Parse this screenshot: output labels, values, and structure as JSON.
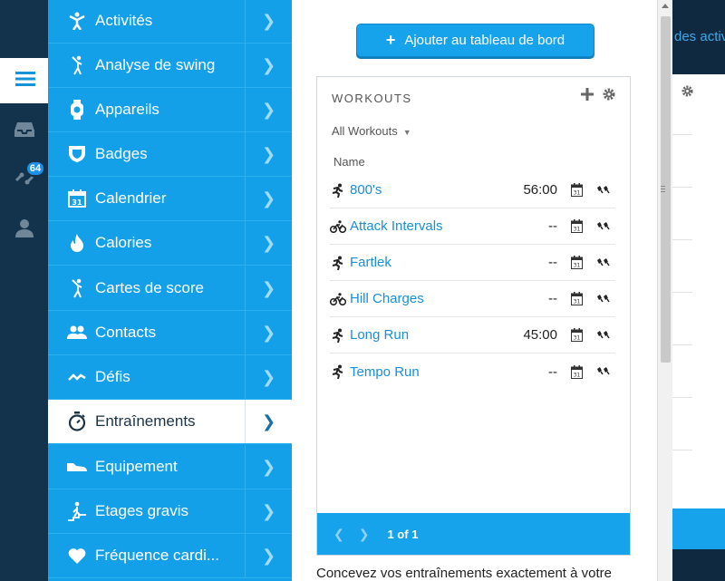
{
  "rail": {
    "items": [
      {
        "name": "menu",
        "icon": "hamburger-icon"
      },
      {
        "name": "inbox",
        "icon": "inbox-icon"
      },
      {
        "name": "connections",
        "icon": "connections-icon",
        "badge": "64"
      },
      {
        "name": "profile",
        "icon": "user-icon"
      }
    ]
  },
  "menu": {
    "items": [
      {
        "label": "Activités",
        "icon": "activity-person-icon"
      },
      {
        "label": "Analyse de swing",
        "icon": "golf-swing-icon"
      },
      {
        "label": "Appareils",
        "icon": "watch-icon"
      },
      {
        "label": "Badges",
        "icon": "shield-badge-icon"
      },
      {
        "label": "Calendrier",
        "icon": "calendar-icon"
      },
      {
        "label": "Calories",
        "icon": "flame-icon"
      },
      {
        "label": "Cartes de score",
        "icon": "golfer-icon"
      },
      {
        "label": "Contacts",
        "icon": "contacts-icon"
      },
      {
        "label": "Défis",
        "icon": "challenge-wave-icon"
      },
      {
        "label": "Entraînements",
        "icon": "stopwatch-icon"
      },
      {
        "label": "Equipement",
        "icon": "shoe-icon"
      },
      {
        "label": "Etages gravis",
        "icon": "stairs-icon"
      },
      {
        "label": "Fréquence cardi...",
        "icon": "heart-icon"
      }
    ],
    "active": "Entraînements"
  },
  "panel": {
    "add_button": "Ajouter au tableau de bord",
    "card": {
      "title": "WORKOUTS",
      "filter": "All Workouts",
      "column_name": "Name",
      "rows": [
        {
          "name": "800's",
          "sport": "running",
          "duration": "56:00"
        },
        {
          "name": "Attack Intervals",
          "sport": "cycling",
          "duration": "--"
        },
        {
          "name": "Fartlek",
          "sport": "running",
          "duration": "--"
        },
        {
          "name": "Hill Charges",
          "sport": "cycling",
          "duration": "--"
        },
        {
          "name": "Long Run",
          "sport": "running",
          "duration": "45:00"
        },
        {
          "name": "Tempo Run",
          "sport": "running",
          "duration": "--"
        }
      ],
      "pager": "1 of 1"
    },
    "description": "Concevez vos entraînements exactement à votre"
  },
  "background": {
    "peek_text": "des activ"
  },
  "colors": {
    "menu_blue": "#14a0e9",
    "rail_dark": "#13324b",
    "link_blue": "#1a8ed8"
  }
}
